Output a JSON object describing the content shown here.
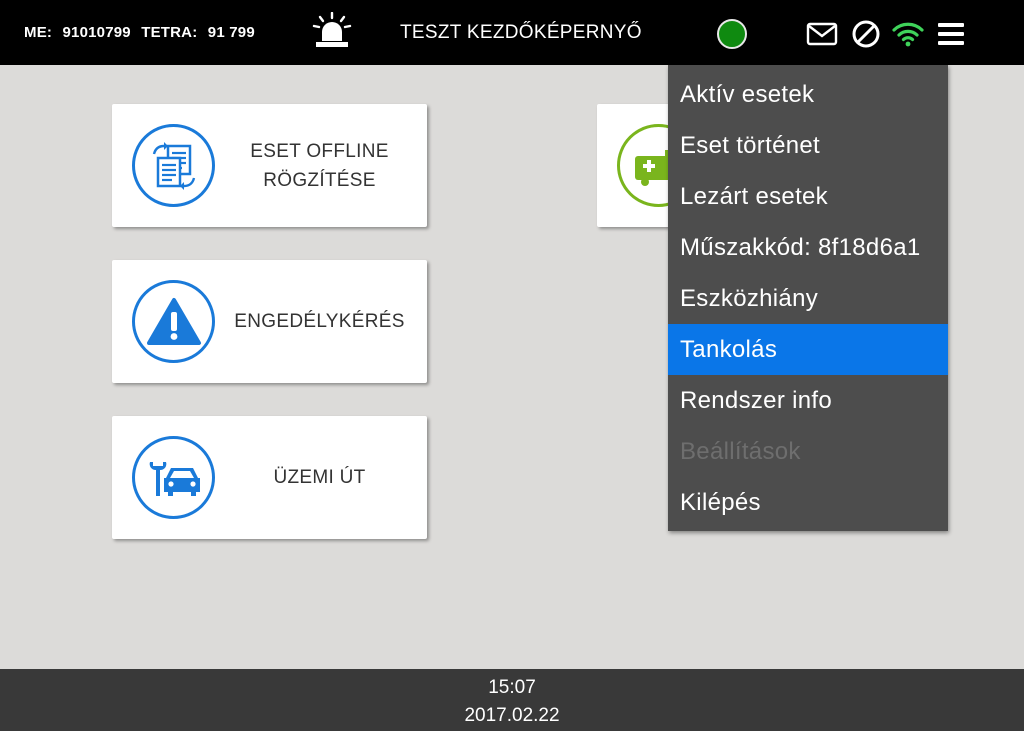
{
  "topbar": {
    "me_label": "ME:",
    "me_value": "91010799",
    "tetra_label": "TETRA:",
    "tetra_value": "91 799",
    "title": "TESZT KEZDŐKÉPERNYŐ",
    "status_color": "#0f8a10",
    "icons": [
      "siren-icon",
      "mail-icon",
      "block-icon",
      "wifi-icon",
      "hamburger-menu-icon"
    ]
  },
  "cards": [
    {
      "label": "ESET OFFLINE\nRÖGZÍTÉSE",
      "icon": "documents-sync-icon"
    },
    {
      "label": "ENGEDÉLYKÉRÉS",
      "icon": "warning-icon"
    },
    {
      "label": "ÜZEMI ÚT",
      "icon": "car-tools-icon"
    },
    {
      "label": "",
      "icon": "ambulance-icon"
    }
  ],
  "menu": {
    "items": [
      {
        "label": "Aktív esetek",
        "state": "normal"
      },
      {
        "label": "Eset történet",
        "state": "normal"
      },
      {
        "label": "Lezárt esetek",
        "state": "normal"
      },
      {
        "label": "Műszakkód: 8f18d6a1",
        "state": "normal"
      },
      {
        "label": "Eszközhiány",
        "state": "normal"
      },
      {
        "label": "Tankolás",
        "state": "active"
      },
      {
        "label": "Rendszer info",
        "state": "normal"
      },
      {
        "label": "Beállítások",
        "state": "disabled"
      },
      {
        "label": "Kilépés",
        "state": "normal"
      }
    ]
  },
  "footer": {
    "time": "15:07",
    "date": "2017.02.22"
  },
  "colors": {
    "accent": "#1a7ad9",
    "active_menu": "#0a76e8",
    "ambulance_green": "#7ab51d"
  }
}
